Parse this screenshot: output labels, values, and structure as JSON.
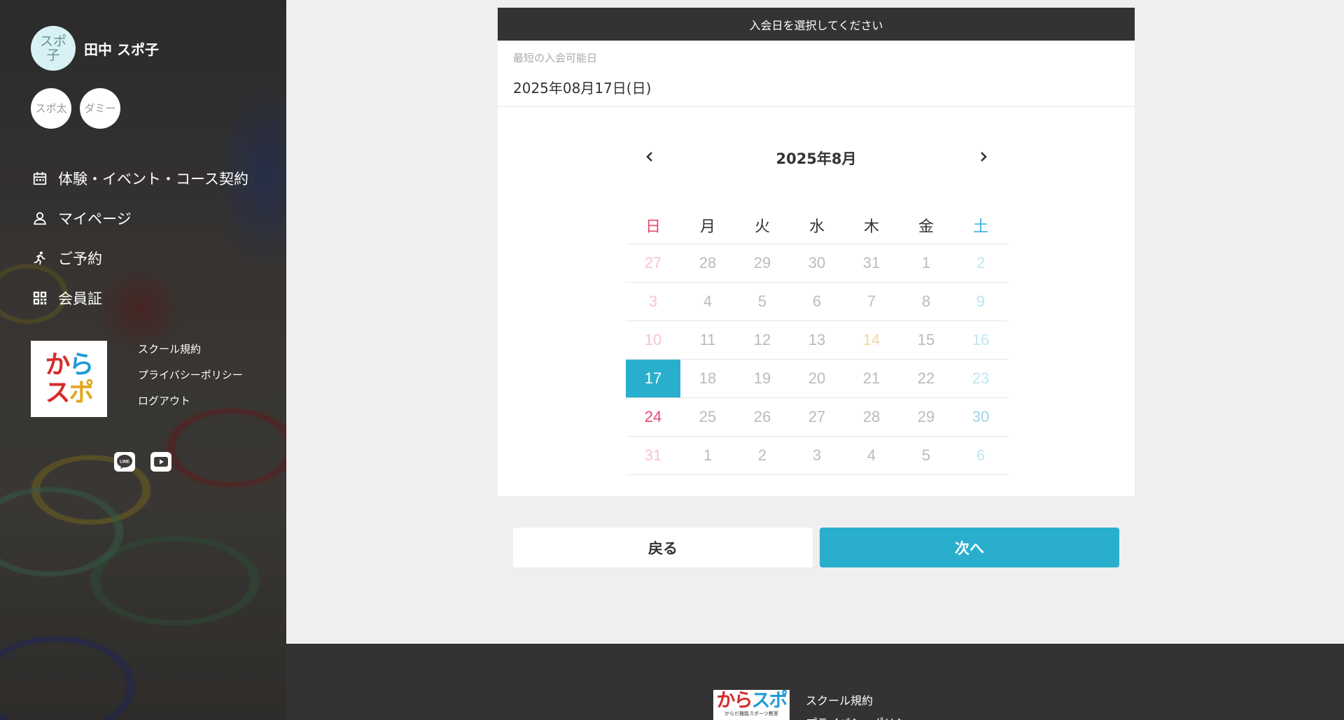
{
  "sidebar": {
    "user": {
      "avatar_text": "スポ子",
      "name": "田中 スポ子"
    },
    "sub_avatars": [
      {
        "text": "スポ太"
      },
      {
        "text": "ダミー"
      }
    ],
    "nav": [
      {
        "label": "体験・イベント・コース契約",
        "icon": "calendar-icon"
      },
      {
        "label": "マイページ",
        "icon": "person-icon"
      },
      {
        "label": "ご予約",
        "icon": "running-icon"
      },
      {
        "label": "会員証",
        "icon": "qr-code-icon"
      }
    ],
    "logo": {
      "line1_a": "か",
      "line1_b": "ら",
      "line2_a": "ス",
      "line2_b": "ポ"
    },
    "links": [
      "スクール規約",
      "プライバシーポリシー",
      "ログアウト"
    ],
    "social": [
      "line-icon",
      "youtube-icon"
    ]
  },
  "main": {
    "header": "入会日を選択してください",
    "earliest_label": "最短の入会可能日",
    "earliest_value": "2025年08月17日(日)",
    "calendar": {
      "title": "2025年8月",
      "weekdays": [
        "日",
        "月",
        "火",
        "水",
        "木",
        "金",
        "土"
      ],
      "weeks": [
        [
          "27",
          "28",
          "29",
          "30",
          "31",
          "1",
          "2"
        ],
        [
          "3",
          "4",
          "5",
          "6",
          "7",
          "8",
          "9"
        ],
        [
          "10",
          "11",
          "12",
          "13",
          "14",
          "15",
          "16"
        ],
        [
          "17",
          "18",
          "19",
          "20",
          "21",
          "22",
          "23"
        ],
        [
          "24",
          "25",
          "26",
          "27",
          "28",
          "29",
          "30"
        ],
        [
          "31",
          "1",
          "2",
          "3",
          "4",
          "5",
          "6"
        ]
      ],
      "selected": "17",
      "holiday": "14"
    },
    "buttons": {
      "back": "戻る",
      "next": "次へ"
    }
  },
  "footer": {
    "logo_text_a": "から",
    "logo_text_b": "スポ",
    "logo_sub": "からだ機能スポーツ教室",
    "links": [
      "スクール規約",
      "プライバシーポリシー"
    ]
  },
  "colors": {
    "accent": "#29afcd",
    "sunday": "#e5486a",
    "saturday": "#3ab3e0",
    "dark": "#333333"
  }
}
